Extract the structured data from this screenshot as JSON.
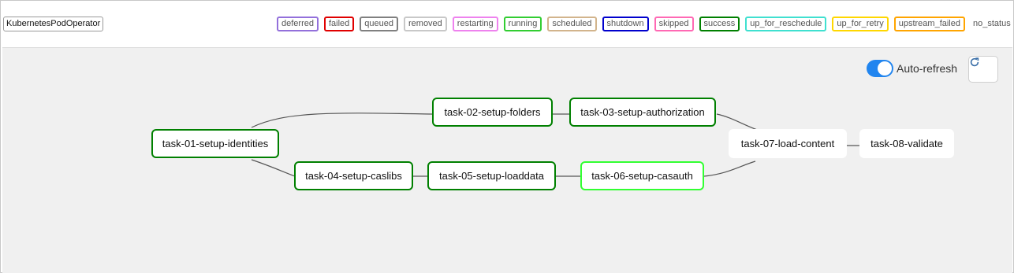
{
  "operator": {
    "label": "KubernetesPodOperator"
  },
  "legend": [
    {
      "label": "deferred",
      "color": "#9370db"
    },
    {
      "label": "failed",
      "color": "#e00000"
    },
    {
      "label": "queued",
      "color": "#808080"
    },
    {
      "label": "removed",
      "color": "#c8c8c8"
    },
    {
      "label": "restarting",
      "color": "#ee82ee"
    },
    {
      "label": "running",
      "color": "#32cd32"
    },
    {
      "label": "scheduled",
      "color": "#d2b48c"
    },
    {
      "label": "shutdown",
      "color": "#0000cd"
    },
    {
      "label": "skipped",
      "color": "#ff69b4"
    },
    {
      "label": "success",
      "color": "#008000"
    },
    {
      "label": "up_for_reschedule",
      "color": "#40e0d0"
    },
    {
      "label": "up_for_retry",
      "color": "#ffd700"
    },
    {
      "label": "upstream_failed",
      "color": "#ffa500"
    }
  ],
  "legend_no_status": "no_status",
  "controls": {
    "auto_refresh_label": "Auto-refresh",
    "auto_refresh_on": true,
    "refresh_icon": "refresh-icon"
  },
  "tasks": [
    {
      "id": "t1",
      "label": "task-01-setup-identities",
      "state": "success"
    },
    {
      "id": "t2",
      "label": "task-02-setup-folders",
      "state": "success"
    },
    {
      "id": "t3",
      "label": "task-03-setup-authorization",
      "state": "success"
    },
    {
      "id": "t4",
      "label": "task-04-setup-caslibs",
      "state": "success"
    },
    {
      "id": "t5",
      "label": "task-05-setup-loaddata",
      "state": "success"
    },
    {
      "id": "t6",
      "label": "task-06-setup-casauth",
      "state": "running"
    },
    {
      "id": "t7",
      "label": "task-07-load-content",
      "state": "no_status"
    },
    {
      "id": "t8",
      "label": "task-08-validate",
      "state": "no_status"
    }
  ]
}
